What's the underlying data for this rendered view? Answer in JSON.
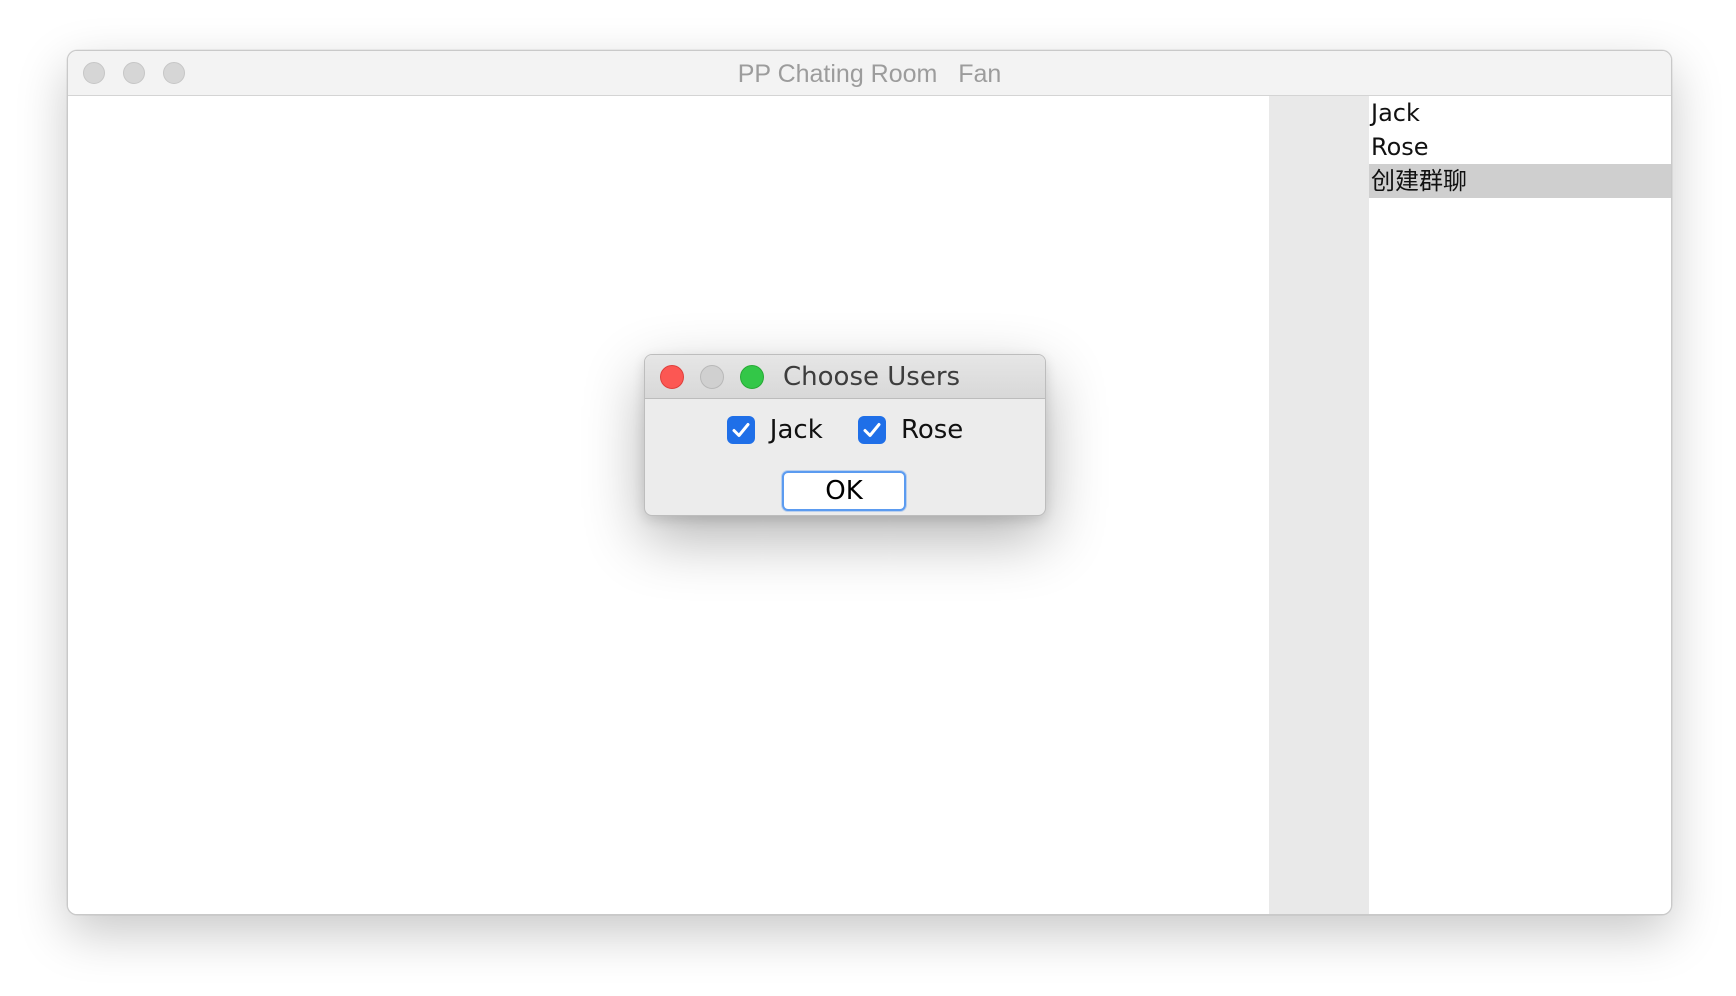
{
  "main_window": {
    "title": "PP Chating Room   Fan",
    "user_list": [
      {
        "label": "Jack",
        "selected": false
      },
      {
        "label": "Rose",
        "selected": false
      },
      {
        "label": "创建群聊",
        "selected": true
      }
    ]
  },
  "dialog": {
    "title": "Choose Users",
    "options": [
      {
        "label": "Jack",
        "checked": true
      },
      {
        "label": "Rose",
        "checked": true
      }
    ],
    "ok_label": "OK"
  },
  "colors": {
    "checkbox_accent": "#1f6fe8",
    "close_button": "#fc5753",
    "maximize_button": "#33c748",
    "selected_row": "#cfcfcf"
  }
}
